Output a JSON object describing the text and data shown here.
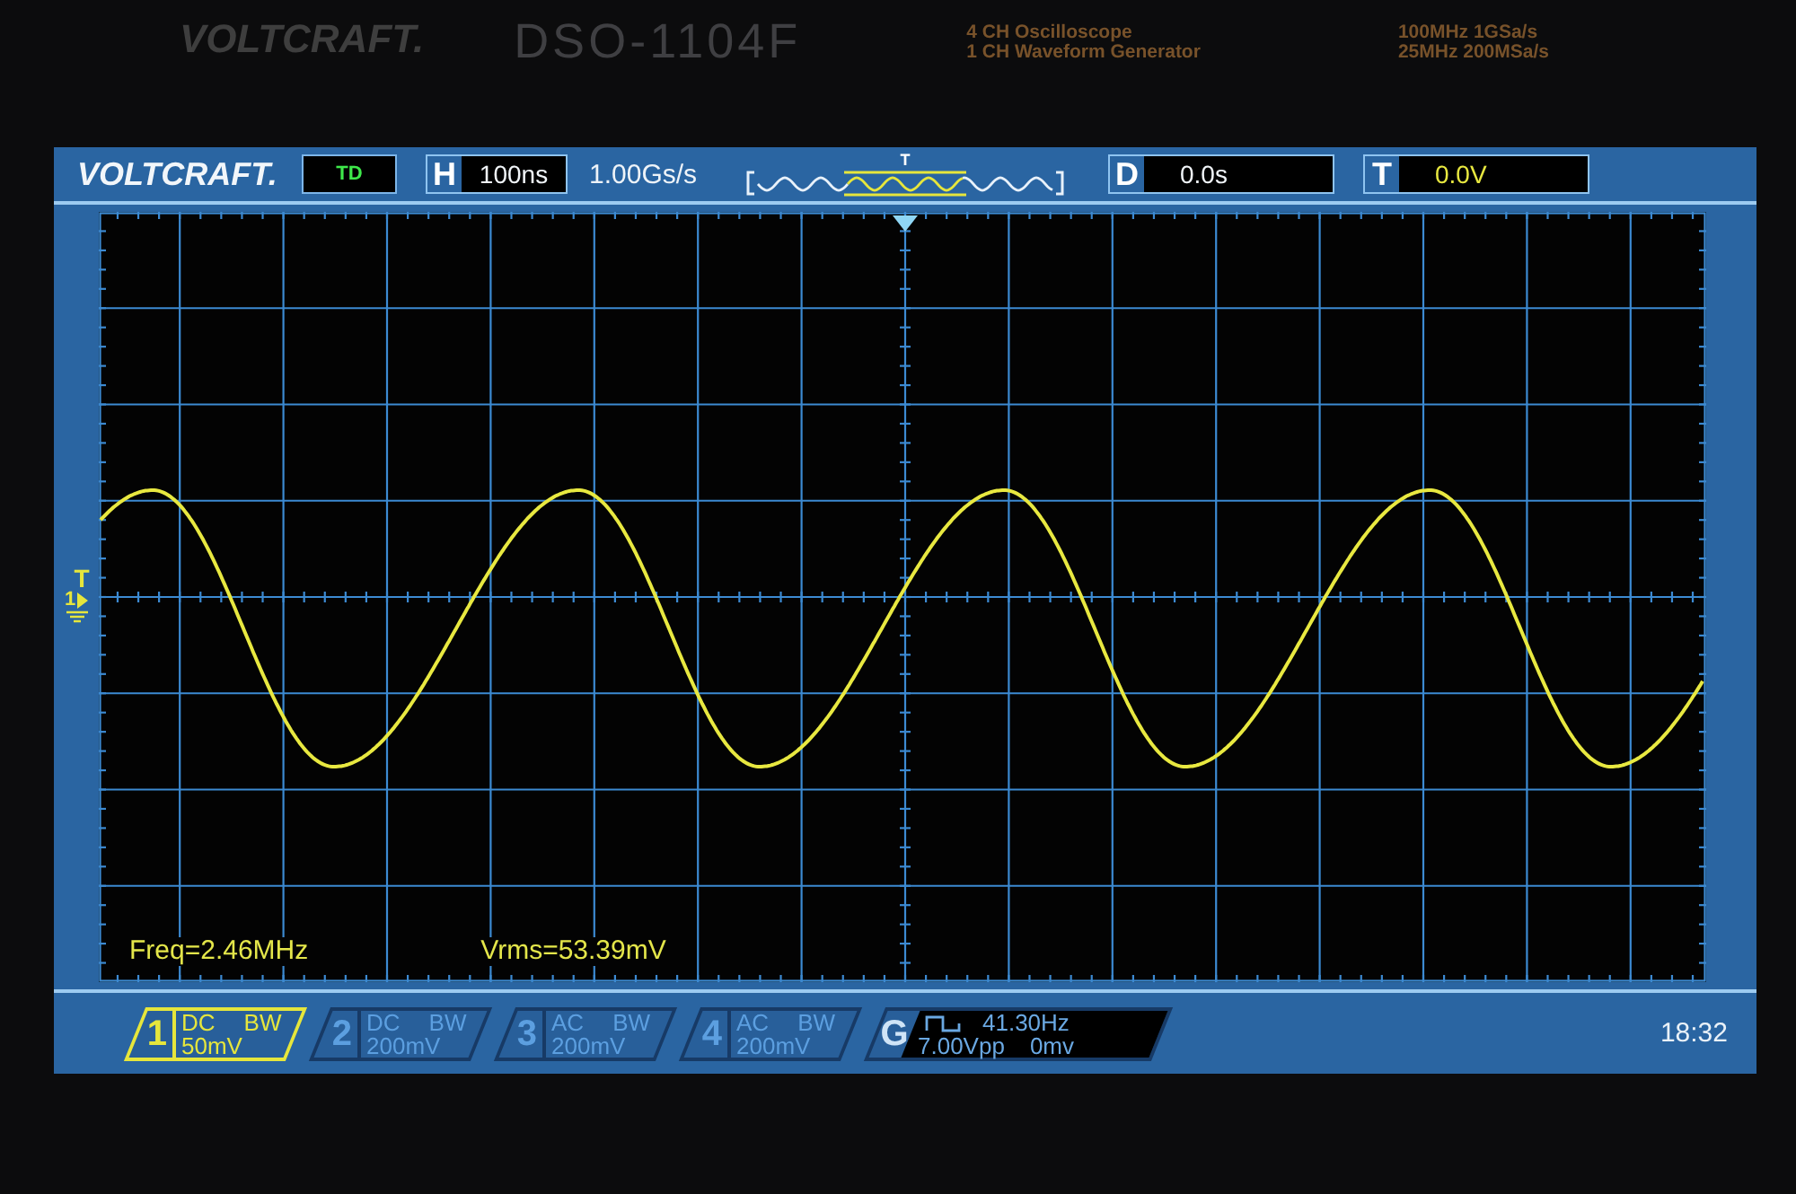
{
  "bezel": {
    "brand": "VOLTCRAFT.",
    "model": "DSO-1104F",
    "description": [
      "4 CH Oscilloscope",
      "1 CH Waveform Generator"
    ],
    "specs": [
      "100MHz 1GSa/s",
      "25MHz 200MSa/s"
    ]
  },
  "top_bar": {
    "logo": "VOLTCRAFT.",
    "mode": "TD",
    "timebase": {
      "label": "H",
      "value": "100ns"
    },
    "sample_rate": "1.00Gs/s",
    "memory_bar": {
      "trigger_label": "T"
    },
    "delay": {
      "label": "D",
      "value": "0.0s"
    },
    "trigger": {
      "label": "T",
      "value": "0.0V"
    }
  },
  "side_markers": {
    "trigger_level": "T",
    "channel": "1"
  },
  "measurements": [
    "Freq=2.46MHz",
    "Vrms=53.39mV"
  ],
  "channels": [
    {
      "number": "1",
      "coupling": "DC",
      "bandwidth": "BW",
      "scale": "50mV",
      "selected": true
    },
    {
      "number": "2",
      "coupling": "DC",
      "bandwidth": "BW",
      "scale": "200mV",
      "selected": false
    },
    {
      "number": "3",
      "coupling": "AC",
      "bandwidth": "BW",
      "scale": "200mV",
      "selected": false
    },
    {
      "number": "4",
      "coupling": "AC",
      "bandwidth": "BW",
      "scale": "200mV",
      "selected": false
    }
  ],
  "generator": {
    "label": "G",
    "frequency": "41.30Hz",
    "amplitude": "7.00Vpp",
    "offset": "0mv"
  },
  "clock": "18:32"
}
